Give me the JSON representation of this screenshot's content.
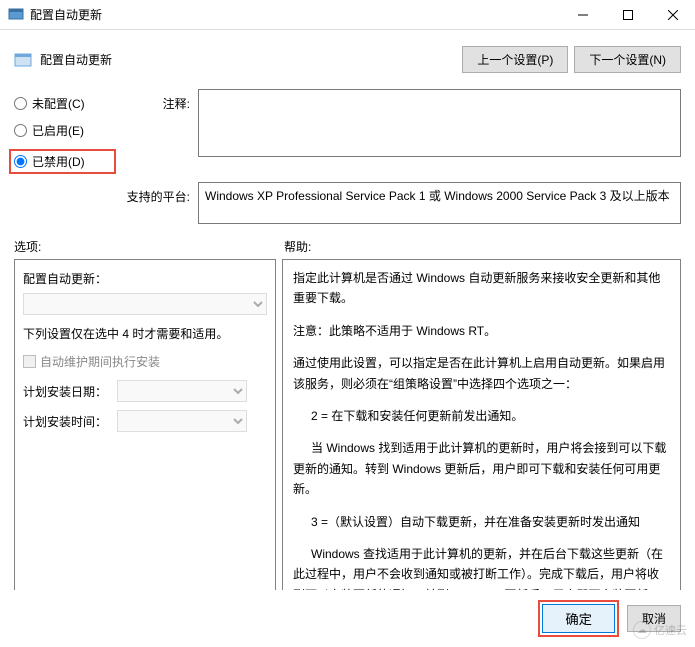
{
  "titlebar": {
    "title": "配置自动更新"
  },
  "header": {
    "title": "配置自动更新",
    "prev_btn": "上一个设置(P)",
    "next_btn": "下一个设置(N)"
  },
  "radio": {
    "not_configured": "未配置(C)",
    "enabled": "已启用(E)",
    "disabled": "已禁用(D)"
  },
  "labels": {
    "comment": "注释:",
    "platforms": "支持的平台:",
    "options": "选项:",
    "help": "帮助:"
  },
  "platforms_text": "Windows XP Professional Service Pack 1 或 Windows 2000 Service Pack 3 及以上版本",
  "options": {
    "configure": "配置自动更新：",
    "note": "下列设置仅在选中 4 时才需要和适用。",
    "maintenance_check": "自动维护期间执行安装",
    "schedule_day": "计划安装日期：",
    "schedule_time": "计划安装时间："
  },
  "help": {
    "p1": "指定此计算机是否通过 Windows 自动更新服务来接收安全更新和其他重要下载。",
    "p2": "注意：此策略不适用于 Windows RT。",
    "p3": "通过使用此设置，可以指定是否在此计算机上启用自动更新。如果启用该服务，则必须在“组策略设置”中选择四个选项之一：",
    "p4": "2 = 在下载和安装任何更新前发出通知。",
    "p5": "当 Windows 找到适用于此计算机的更新时，用户将会接到可以下载更新的通知。转到 Windows 更新后，用户即可下载和安装任何可用更新。",
    "p6": "3 =（默认设置）自动下载更新，并在准备安装更新时发出通知",
    "p7": "Windows 查找适用于此计算机的更新，并在后台下载这些更新（在此过程中，用户不会收到通知或被打断工作）。完成下载后，用户将收到可以安装更新的通知。转到 Windows 更新后，用户即可安装更新。"
  },
  "footer": {
    "ok": "确定",
    "cancel": "取消"
  },
  "watermark": "亿速云"
}
